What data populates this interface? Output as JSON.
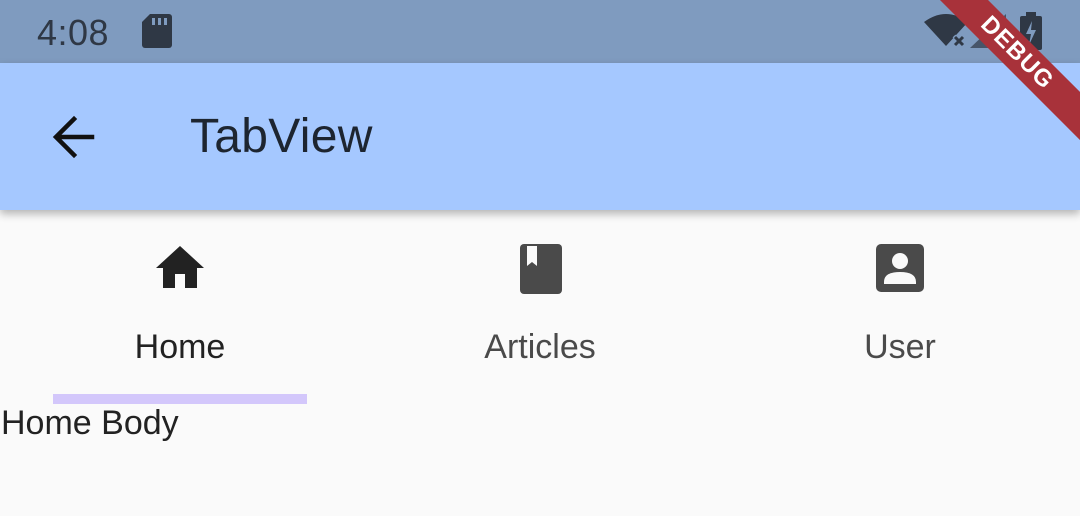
{
  "status_bar": {
    "time": "4:08",
    "icons": [
      "sd-card-icon",
      "wifi-off-icon",
      "signal-icon",
      "battery-icon"
    ]
  },
  "app_bar": {
    "back_icon": "arrow-back-icon",
    "title": "TabView"
  },
  "tabs": [
    {
      "label": "Home",
      "icon": "home-icon",
      "selected": true
    },
    {
      "label": "Articles",
      "icon": "book-icon",
      "selected": false
    },
    {
      "label": "User",
      "icon": "account-box-icon",
      "selected": false
    }
  ],
  "body": {
    "text": "Home Body"
  },
  "debug_banner": {
    "text": "DEBUG"
  },
  "colors": {
    "status_bar": "#7f9bbf",
    "app_bar": "#a5c8ff",
    "tab_indicator": "#d3c7fb",
    "background": "#fafafa",
    "debug_banner": "#a8323a"
  }
}
